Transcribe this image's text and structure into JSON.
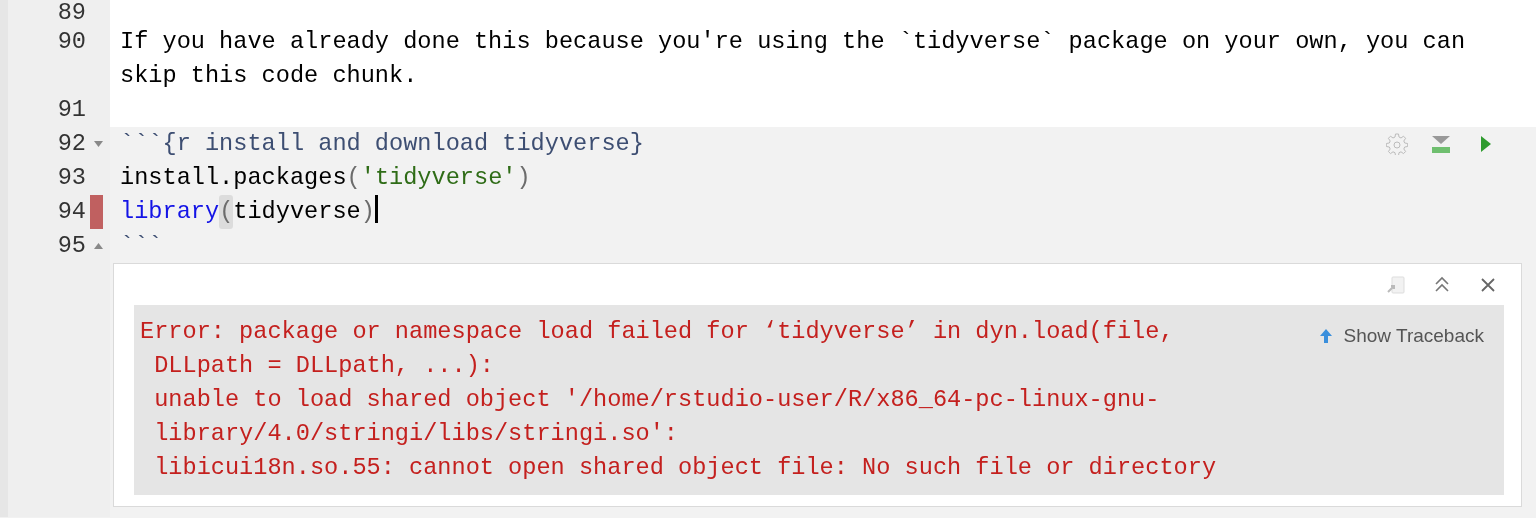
{
  "editor": {
    "lines": [
      {
        "number": "89",
        "chunk": false
      },
      {
        "number": "90",
        "chunk": false,
        "tokens": [
          {
            "kind": "prose",
            "text": "If you have already done this because you're using the `tidyverse` package on your own, you can skip this code chunk."
          }
        ]
      },
      {
        "number": "91",
        "chunk": false
      },
      {
        "number": "92",
        "fold_start": true,
        "chunk": true,
        "toolbar": true,
        "tokens": [
          {
            "kind": "chunk",
            "text": "```{r install and download tidyverse}"
          }
        ]
      },
      {
        "number": "93",
        "chunk": true,
        "tokens": [
          {
            "kind": "plain",
            "text": "install.packages"
          },
          {
            "kind": "paren",
            "text": "("
          },
          {
            "kind": "string",
            "text": "'tidyverse'"
          },
          {
            "kind": "paren",
            "text": ")"
          }
        ]
      },
      {
        "number": "94",
        "marked": true,
        "chunk": true,
        "cursor": true,
        "tokens": [
          {
            "kind": "keyword",
            "text": "library"
          },
          {
            "kind": "paren_match",
            "text": "("
          },
          {
            "kind": "plain",
            "text": "tidyverse"
          },
          {
            "kind": "paren",
            "text": ")"
          }
        ]
      },
      {
        "number": "95",
        "fold_end": true,
        "chunk": true,
        "tokens": [
          {
            "kind": "chunk",
            "text": "```"
          }
        ]
      }
    ]
  },
  "output": {
    "traceback_link": "Show Traceback",
    "error_lines": [
      "Error: package or namespace load failed for ‘tidyverse’ in dyn.load(file,",
      " DLLpath = DLLpath, ...):",
      " unable to load shared object '/home/rstudio-user/R/x86_64-pc-linux-gnu-",
      " library/4.0/stringi/libs/stringi.so':",
      " libicui18n.so.55: cannot open shared object file: No such file or directory"
    ]
  }
}
